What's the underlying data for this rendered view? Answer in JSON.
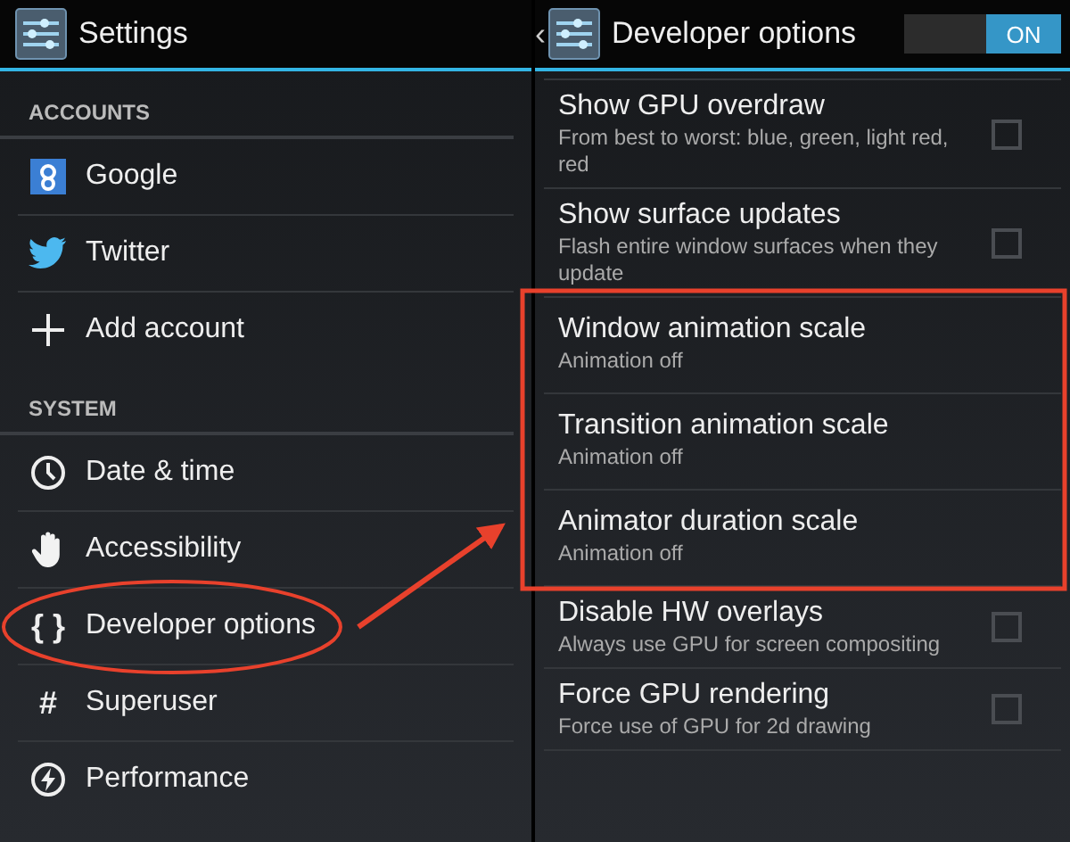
{
  "settings": {
    "title": "Settings",
    "sections": [
      {
        "header": "ACCOUNTS",
        "items": [
          {
            "label": "Google",
            "kind": "google",
            "circled": false
          },
          {
            "label": "Twitter",
            "kind": "bird",
            "circled": false
          },
          {
            "label": "Add account",
            "kind": "plus",
            "circled": false
          }
        ]
      },
      {
        "header": "SYSTEM",
        "items": [
          {
            "label": "Date & time",
            "kind": "clock",
            "circled": false
          },
          {
            "label": "Accessibility",
            "kind": "hand",
            "circled": false
          },
          {
            "label": "Developer options",
            "kind": "glyph",
            "glyph": "{ }",
            "circled": true
          },
          {
            "label": "Superuser",
            "kind": "glyph",
            "glyph": "#",
            "circled": false
          },
          {
            "label": "Performance",
            "kind": "bolt",
            "circled": false
          }
        ]
      }
    ]
  },
  "developer": {
    "back": "‹",
    "title": "Developer options",
    "toggle": {
      "label": "ON",
      "on": true
    },
    "prefs": [
      {
        "kind": "checkbox",
        "title": "Show GPU overdraw",
        "summary": "From best to worst: blue, green, light red, red",
        "checked": false,
        "highlighted": false
      },
      {
        "kind": "checkbox",
        "title": "Show surface updates",
        "summary": "Flash entire window surfaces when they update",
        "checked": false,
        "highlighted": false
      },
      {
        "kind": "value",
        "title": "Window animation scale",
        "summary": "Animation off",
        "highlighted": true
      },
      {
        "kind": "value",
        "title": "Transition animation scale",
        "summary": "Animation off",
        "highlighted": true
      },
      {
        "kind": "value",
        "title": "Animator duration scale",
        "summary": "Animation off",
        "highlighted": true
      },
      {
        "kind": "checkbox",
        "title": "Disable HW overlays",
        "summary": "Always use GPU for screen compositing",
        "checked": false,
        "highlighted": false
      },
      {
        "kind": "checkbox",
        "title": "Force GPU rendering",
        "summary": "Force use of GPU for 2d drawing",
        "checked": false,
        "highlighted": false
      }
    ]
  }
}
